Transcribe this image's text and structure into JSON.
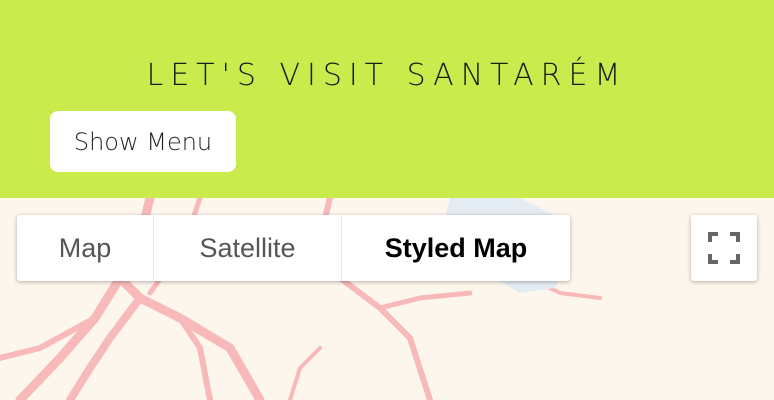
{
  "header": {
    "title": "LET'S VISIT SANTARÉM",
    "menu_button": "Show Menu",
    "background_color": "#c9eb4b"
  },
  "map": {
    "type_control": {
      "tabs": [
        {
          "label": "Map",
          "active": false
        },
        {
          "label": "Satellite",
          "active": false
        },
        {
          "label": "Styled Map",
          "active": true
        }
      ]
    },
    "fullscreen_icon": "fullscreen-icon",
    "background_color": "#fdf6ec",
    "road_color": "#f7b9b9"
  }
}
